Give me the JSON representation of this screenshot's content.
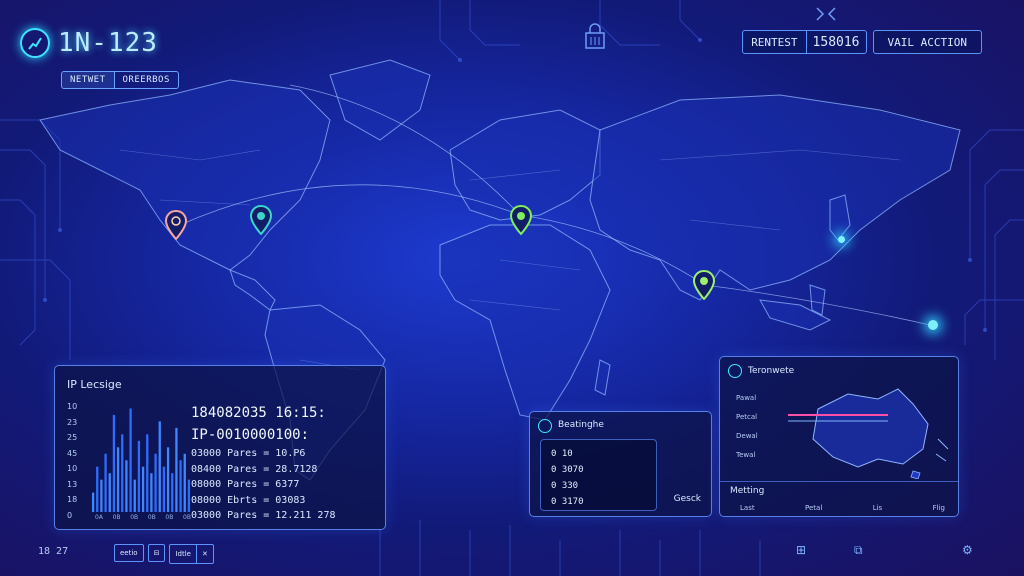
{
  "header": {
    "title": "1N-123",
    "tabs": [
      {
        "label": "NETWET",
        "active": true
      },
      {
        "label": "OREERBOS",
        "active": false
      }
    ]
  },
  "topbar": {
    "refresh_label": "RENTEST",
    "refresh_value": "158016",
    "action_label": "VAIL ACCTION"
  },
  "map": {
    "markers": [
      {
        "name": "marker-west-us",
        "color": "#f4a6a0"
      },
      {
        "name": "marker-east-us",
        "color": "#3ad6c8"
      },
      {
        "name": "marker-europe",
        "color": "#7ef05a"
      },
      {
        "name": "marker-india",
        "color": "#9df06a"
      }
    ]
  },
  "ip_panel": {
    "title": "IP Lecsige",
    "y_ticks": [
      "10",
      "23",
      "25",
      "45",
      "10",
      "13",
      "18",
      "0"
    ],
    "x_ticks": [
      "0A",
      "0B",
      "0B",
      "0B",
      "0B",
      "0B"
    ],
    "timestamp": "184082035 16:15:",
    "ip": "IP-0010000100:",
    "rows": [
      "03000 Pares = 10.P6",
      "08400 Pares = 28.7128",
      "08000 Pares = 6377",
      "08000 Ebrts = 03083",
      "03000 Pares = 12.211 278"
    ]
  },
  "chart_data": {
    "type": "bar",
    "categories": [
      "1",
      "2",
      "3",
      "4",
      "5",
      "6",
      "7",
      "8",
      "9",
      "10",
      "11",
      "12",
      "13",
      "14",
      "15",
      "16",
      "17",
      "18",
      "19",
      "20",
      "21",
      "22",
      "23",
      "24"
    ],
    "values": [
      3,
      7,
      5,
      9,
      6,
      15,
      10,
      12,
      8,
      16,
      5,
      11,
      7,
      12,
      6,
      9,
      14,
      7,
      10,
      6,
      13,
      8,
      9,
      5
    ],
    "ylim": [
      0,
      17
    ]
  },
  "mid_panel": {
    "title": "Beatinghe",
    "items": [
      "0 10",
      "0 3070",
      "0 330",
      "0 3170"
    ],
    "button": "Gesck"
  },
  "au_panel": {
    "title": "Teronwete",
    "labels": [
      "Pawal",
      "Petcal",
      "Dewal",
      "Tewal"
    ],
    "bottom_title": "Metting",
    "columns": [
      "Last",
      "Petal",
      "Lis",
      "Flig"
    ]
  },
  "footer": {
    "left_label": "18 27",
    "btn1": "eetio",
    "btn2": "Idtle",
    "btn3": "✕"
  }
}
